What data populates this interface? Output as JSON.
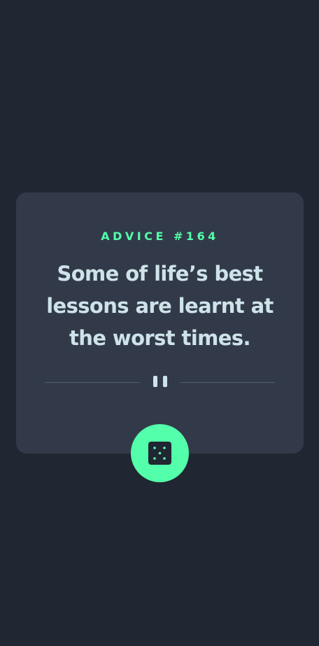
{
  "card": {
    "label": "ADVICE #164",
    "quote": "Some of life’s best lessons are learnt at the worst times."
  },
  "icons": {
    "divider": "pause-icon",
    "button": "dice-icon"
  },
  "colors": {
    "background": "#202632",
    "card": "#323a49",
    "accent": "#53ffaa",
    "text": "#cee3e9",
    "divider": "#4f5d74"
  }
}
